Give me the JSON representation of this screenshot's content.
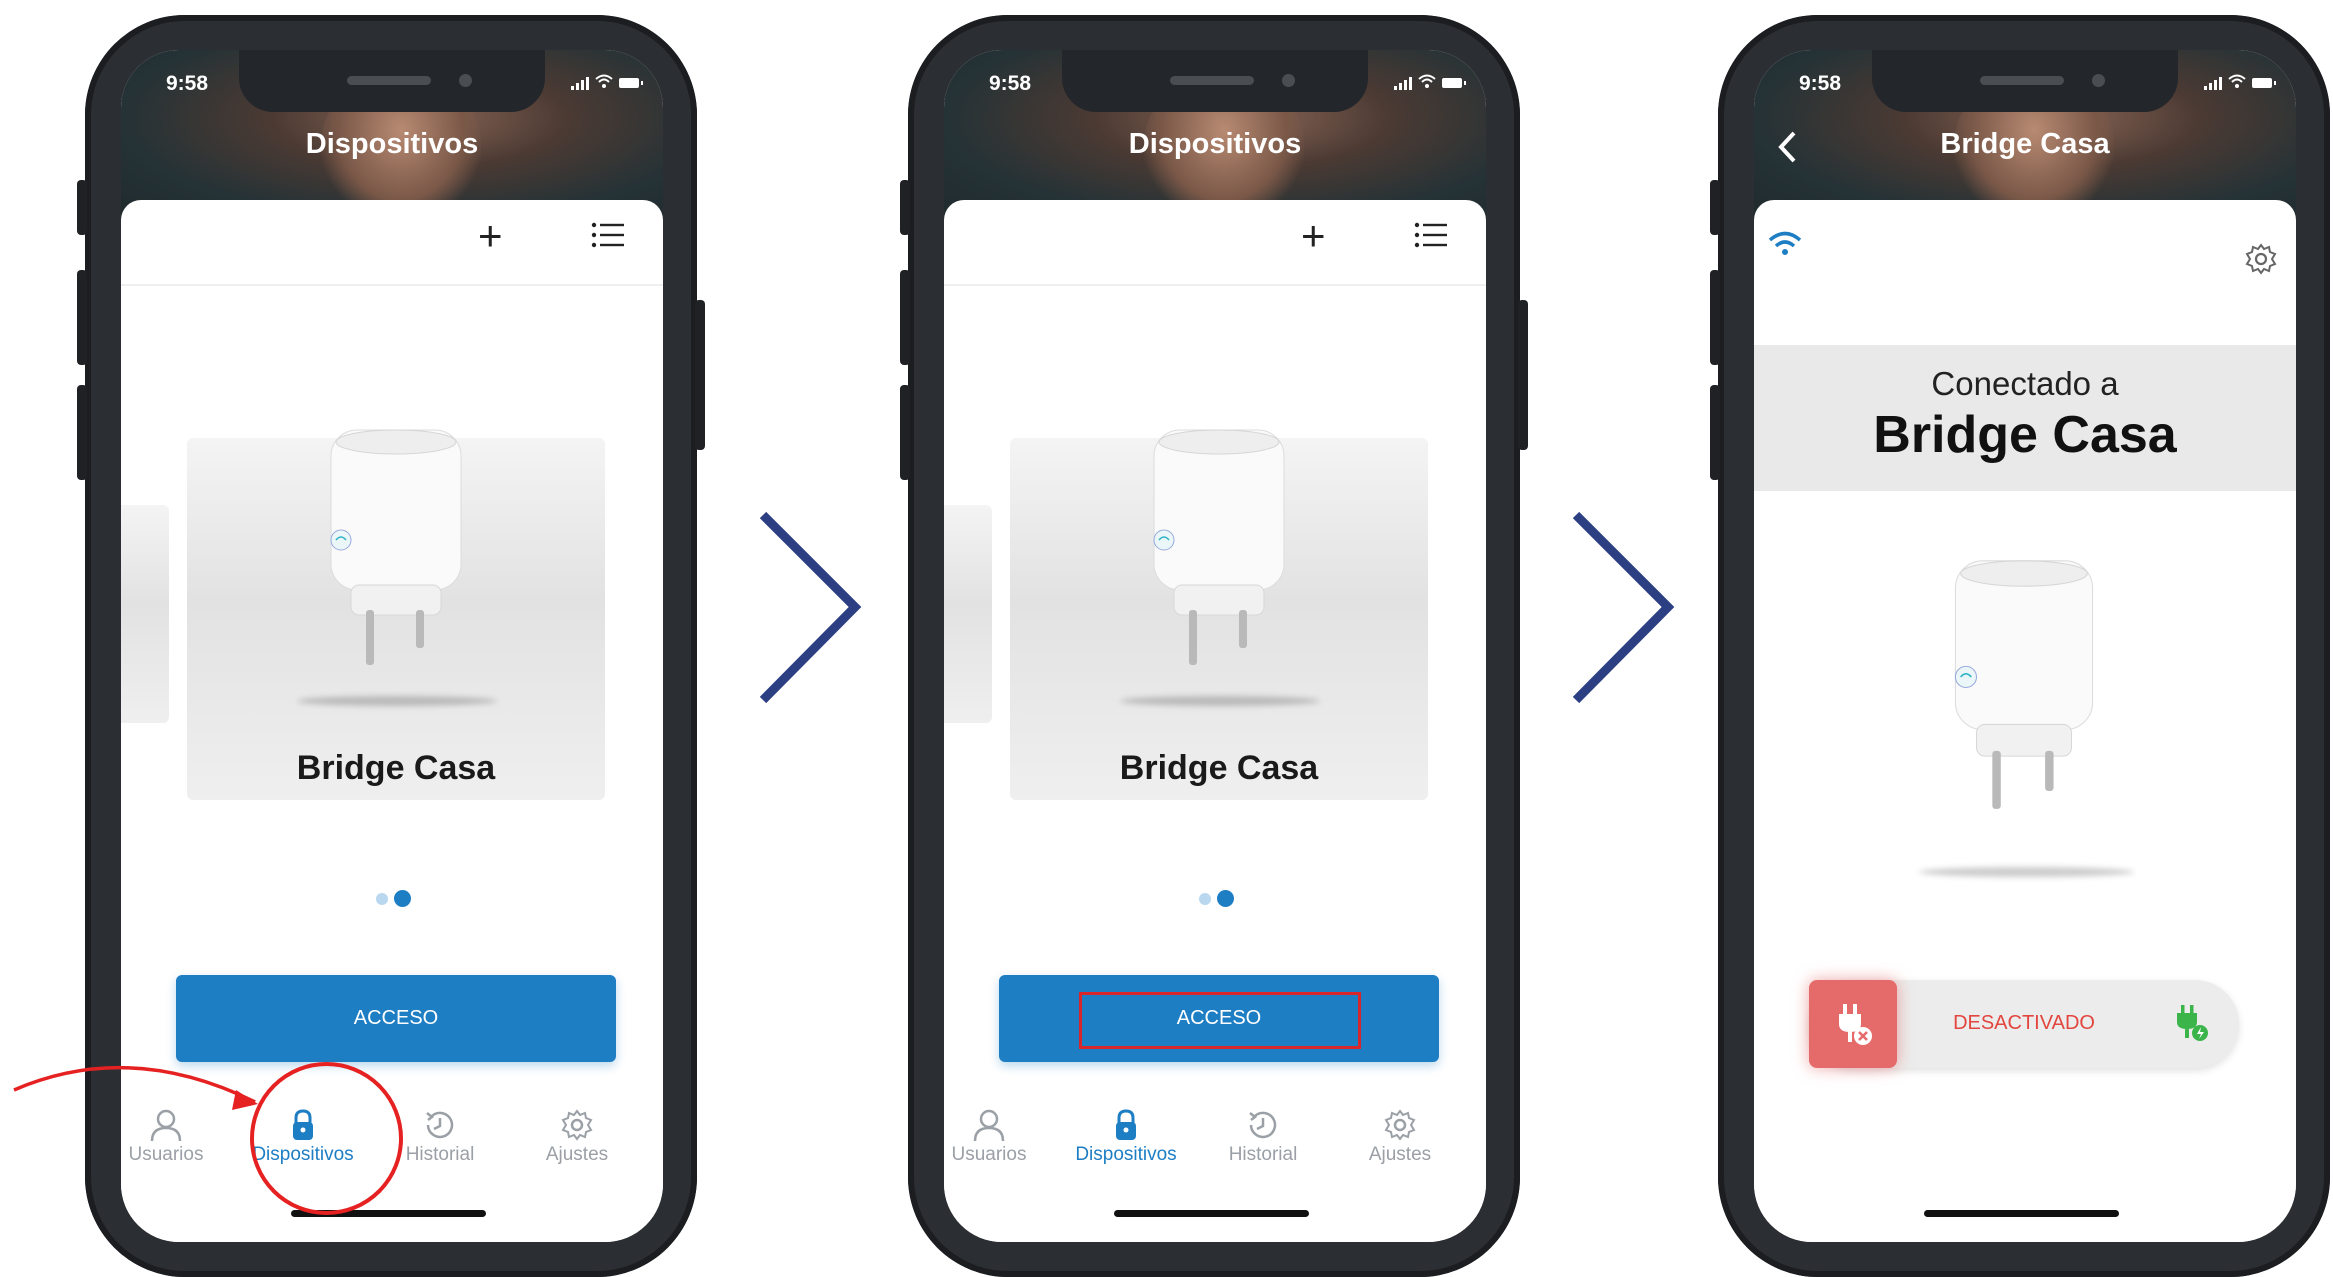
{
  "colors": {
    "accent": "#1e7ec4",
    "annotation_red": "#e52121",
    "chevron": "#2c3f82",
    "off_state": "#e2463f",
    "on_state": "#3bb54a"
  },
  "screens": [
    {
      "status_time": "9:58",
      "header_title": "Dispositivos",
      "device_name": "Bridge Casa",
      "access_label": "ACCESO",
      "tabs": [
        "Usuarios",
        "Dispositivos",
        "Historial",
        "Ajustes"
      ],
      "active_tab": "Dispositivos",
      "annotation": "circle-on-dispositivos-tab"
    },
    {
      "status_time": "9:58",
      "header_title": "Dispositivos",
      "device_name": "Bridge Casa",
      "access_label": "ACCESO",
      "tabs": [
        "Usuarios",
        "Dispositivos",
        "Historial",
        "Ajustes"
      ],
      "active_tab": "Dispositivos",
      "annotation": "rectangle-on-acceso-button"
    },
    {
      "status_time": "9:58",
      "header_title": "Bridge Casa",
      "connected_label": "Conectado a",
      "connected_device": "Bridge Casa",
      "toggle_state": "DESACTIVADO"
    }
  ]
}
